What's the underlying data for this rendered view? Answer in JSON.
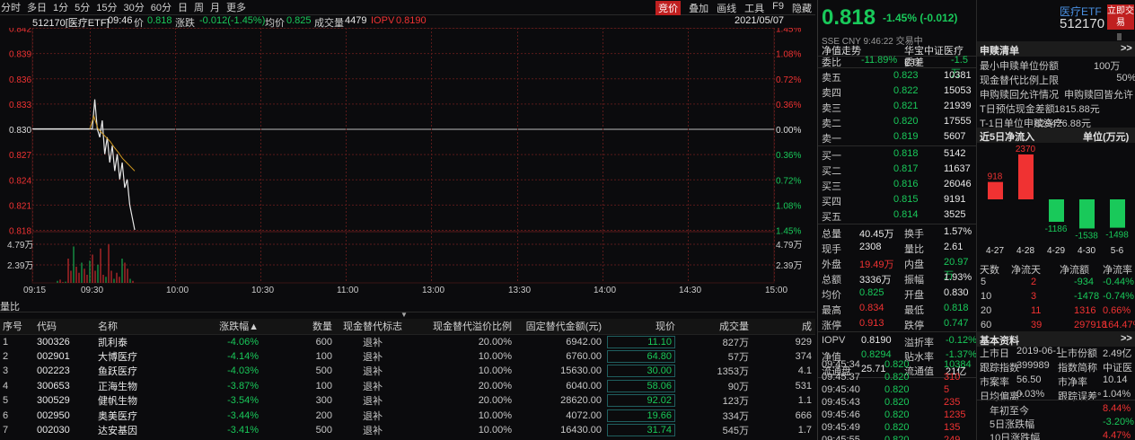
{
  "toolbar": {
    "periods": [
      "分时",
      "多日",
      "1分",
      "5分",
      "15分",
      "30分",
      "60分",
      "日",
      "周",
      "月",
      "更多"
    ],
    "right": [
      "竞价",
      "叠加",
      "画线",
      "工具",
      "F9",
      "隐藏"
    ]
  },
  "info": {
    "code_name": "512170[医疗ETF]",
    "time": "09:46",
    "price_label": "价",
    "price": "0.818",
    "chg_label": "涨跌",
    "chg": "-0.012(-1.45%)",
    "avg_label": "均价",
    "avg": "0.825",
    "vol_label": "成交量",
    "vol": "4479",
    "iopv_label": "IOPV",
    "iopv": "0.8190",
    "date": "2021/05/07"
  },
  "chart_data": {
    "type": "line",
    "x_ticks": [
      "09:15",
      "09:30",
      "10:00",
      "10:30",
      "11:00",
      "13:00",
      "13:30",
      "14:00",
      "14:30",
      "15:00"
    ],
    "y_left": [
      "0.842",
      "0.839",
      "0.836",
      "0.833",
      "0.830",
      "0.827",
      "0.824",
      "0.821",
      "0.818"
    ],
    "y_right": [
      "1.45%",
      "1.08%",
      "0.72%",
      "0.36%",
      "0.00%",
      "0.36%",
      "0.72%",
      "1.08%",
      "1.45%"
    ],
    "vol_ticks": [
      "4.79万",
      "2.39万"
    ],
    "ylim": [
      0.818,
      0.842
    ],
    "base": 0.83,
    "price_series": [
      0.83,
      0.83,
      0.8335,
      0.83,
      0.829,
      0.831,
      0.827,
      0.829,
      0.826,
      0.828,
      0.825,
      0.827,
      0.824,
      0.826,
      0.823,
      0.824,
      0.821,
      0.8195,
      0.818
    ],
    "avg_series": [
      0.83,
      0.8315,
      0.83,
      0.8295,
      0.829,
      0.8285,
      0.8278,
      0.8272,
      0.8265,
      0.826,
      0.8255,
      0.825
    ],
    "series": [
      {
        "values": [
          0.83,
          0.83,
          0.8335,
          0.83,
          0.829,
          0.831,
          0.827,
          0.829,
          0.826,
          0.828,
          0.825,
          0.827,
          0.824,
          0.826,
          0.823,
          0.824,
          0.821,
          0.8195,
          0.818
        ]
      },
      {
        "values": [
          0.83,
          0.8315,
          0.83,
          0.8295,
          0.829,
          0.8285,
          0.8278,
          0.8272,
          0.8265,
          0.826,
          0.8255,
          0.825
        ]
      }
    ],
    "volumes": [
      0.05,
      0.08,
      0.02,
      0.03,
      0.6,
      0.3,
      0.9,
      0.4,
      0.25,
      0.5,
      0.35,
      0.2,
      0.55,
      0.7,
      0.3,
      0.45,
      0.85,
      0.2,
      0.15,
      0.95,
      0.3,
      0.1,
      0.25,
      0.15,
      0.6,
      0.5,
      0.35,
      0.1,
      0.05
    ]
  },
  "vol_label": "量比",
  "table": {
    "headers": [
      "序号",
      "代码",
      "名称",
      "涨跌幅▲",
      "数量",
      "现金替代标志",
      "现金替代溢价比例",
      "固定替代金额(元)",
      "现价",
      "成交量",
      "成"
    ],
    "rows": [
      [
        "1",
        "300326",
        "凯利泰",
        "-4.06%",
        "600",
        "退补",
        "20.00%",
        "6942.00",
        "11.10",
        "827万",
        "929"
      ],
      [
        "2",
        "002901",
        "大博医疗",
        "-4.14%",
        "100",
        "退补",
        "10.00%",
        "6760.00",
        "64.80",
        "57万",
        "374"
      ],
      [
        "3",
        "002223",
        "鱼跃医疗",
        "-4.03%",
        "500",
        "退补",
        "10.00%",
        "15630.00",
        "30.00",
        "1353万",
        "4.1"
      ],
      [
        "4",
        "300653",
        "正海生物",
        "-3.87%",
        "100",
        "退补",
        "20.00%",
        "6040.00",
        "58.06",
        "90万",
        "531"
      ],
      [
        "5",
        "300529",
        "健帆生物",
        "-3.54%",
        "300",
        "退补",
        "20.00%",
        "28620.00",
        "92.02",
        "123万",
        "1.1"
      ],
      [
        "6",
        "002950",
        "奥美医疗",
        "-3.44%",
        "200",
        "退补",
        "10.00%",
        "4072.00",
        "19.66",
        "334万",
        "666"
      ],
      [
        "7",
        "002030",
        "达安基因",
        "-3.41%",
        "500",
        "退补",
        "10.00%",
        "16430.00",
        "31.74",
        "545万",
        "1.7"
      ]
    ]
  },
  "quote": {
    "price": "0.818",
    "chg": "-1.45% (-0.012)",
    "name": "医疗ETF",
    "code": "512170",
    "trade_btn": "立即交易",
    "sub": "SSE  CNY  9:46:22  交易中",
    "nav_tab": "净值走势",
    "fund_name": "华宝中证医疗ETF",
    "weibi_label": "委比",
    "weibi": "-11.89%",
    "weicha_label": "委差",
    "weicha": "-1.5万",
    "asks": [
      [
        "卖五",
        "0.823",
        "10381"
      ],
      [
        "卖四",
        "0.822",
        "15053"
      ],
      [
        "卖三",
        "0.821",
        "21939"
      ],
      [
        "卖二",
        "0.820",
        "17555"
      ],
      [
        "卖一",
        "0.819",
        "5607"
      ]
    ],
    "bids": [
      [
        "买一",
        "0.818",
        "5142"
      ],
      [
        "买二",
        "0.817",
        "11637"
      ],
      [
        "买三",
        "0.816",
        "26046"
      ],
      [
        "买四",
        "0.815",
        "9191"
      ],
      [
        "买五",
        "0.814",
        "3525"
      ]
    ],
    "stats": [
      [
        "总量",
        "40.45万",
        "换手",
        "1.57%"
      ],
      [
        "现手",
        "2308",
        "量比",
        "2.61"
      ],
      [
        "外盘",
        "19.49万",
        "内盘",
        "20.97万"
      ],
      [
        "总额",
        "3336万",
        "振幅",
        "1.93%"
      ],
      [
        "均价",
        "0.825",
        "开盘",
        "0.830"
      ],
      [
        "最高",
        "0.834",
        "最低",
        "0.818"
      ],
      [
        "涨停",
        "0.913",
        "跌停",
        "0.747"
      ]
    ],
    "iopv": [
      [
        "IOPV",
        "0.8190",
        "溢折率",
        "-0.12%"
      ],
      [
        "净值",
        "0.8294",
        "贴水率",
        "-1.37%"
      ],
      [
        "流通盘",
        "25.71",
        "流通值",
        "21亿"
      ]
    ],
    "ticks": [
      [
        "09:45:34",
        "0.820",
        "10384"
      ],
      [
        "09:45:37",
        "0.820",
        "310"
      ],
      [
        "09:45:40",
        "0.820",
        "5"
      ],
      [
        "09:45:43",
        "0.820",
        "235"
      ],
      [
        "09:45:46",
        "0.820",
        "1235"
      ],
      [
        "09:45:49",
        "0.820",
        "135"
      ],
      [
        "09:45:55",
        "0.820",
        "249"
      ]
    ]
  },
  "side": {
    "shengou_title": "申赎清单",
    "more": ">>",
    "shengou": [
      [
        "最小申赎单位份额",
        "100万"
      ],
      [
        "现金替代比例上限",
        "50%"
      ],
      [
        "申购赎回允许情况",
        "申购赎回皆允许"
      ],
      [
        "T日预估现金差额",
        "1815.88元"
      ],
      [
        "T-1日单位申赎资产",
        "829426.88元"
      ]
    ],
    "flow_title": "近5日净流入",
    "flow_unit": "单位(万元)",
    "flow_values": [
      918,
      2370,
      -1186,
      -1538,
      -1498
    ],
    "flow_dates": [
      "4-27",
      "4-28",
      "4-29",
      "4-30",
      "5-6"
    ],
    "flow_table_headers": [
      "天数",
      "净流天",
      "净流额",
      "净流率"
    ],
    "flow_table": [
      [
        "5",
        "2",
        "-934",
        "-0.44%"
      ],
      [
        "10",
        "3",
        "-1478",
        "-0.74%"
      ],
      [
        "20",
        "11",
        "1316",
        "0.66%"
      ],
      [
        "60",
        "39",
        "297918",
        "164.47%"
      ]
    ],
    "basic_title": "基本资料",
    "basic": [
      [
        "上市日",
        "2019-06-1",
        "上市份额",
        "2.49亿"
      ],
      [
        "跟踪指数",
        "399989",
        "指数简称",
        "中证医"
      ],
      [
        "市案率",
        "56.50",
        "市净率",
        "10.14"
      ],
      [
        "日均偏离°",
        "0.03%",
        "跟踪误差°",
        "1.04%"
      ]
    ],
    "perf": [
      [
        "年初至今",
        "8.44%"
      ],
      [
        "5日涨跌幅",
        "-3.20%"
      ],
      [
        "10日涨跌幅",
        "4.47%"
      ]
    ]
  }
}
